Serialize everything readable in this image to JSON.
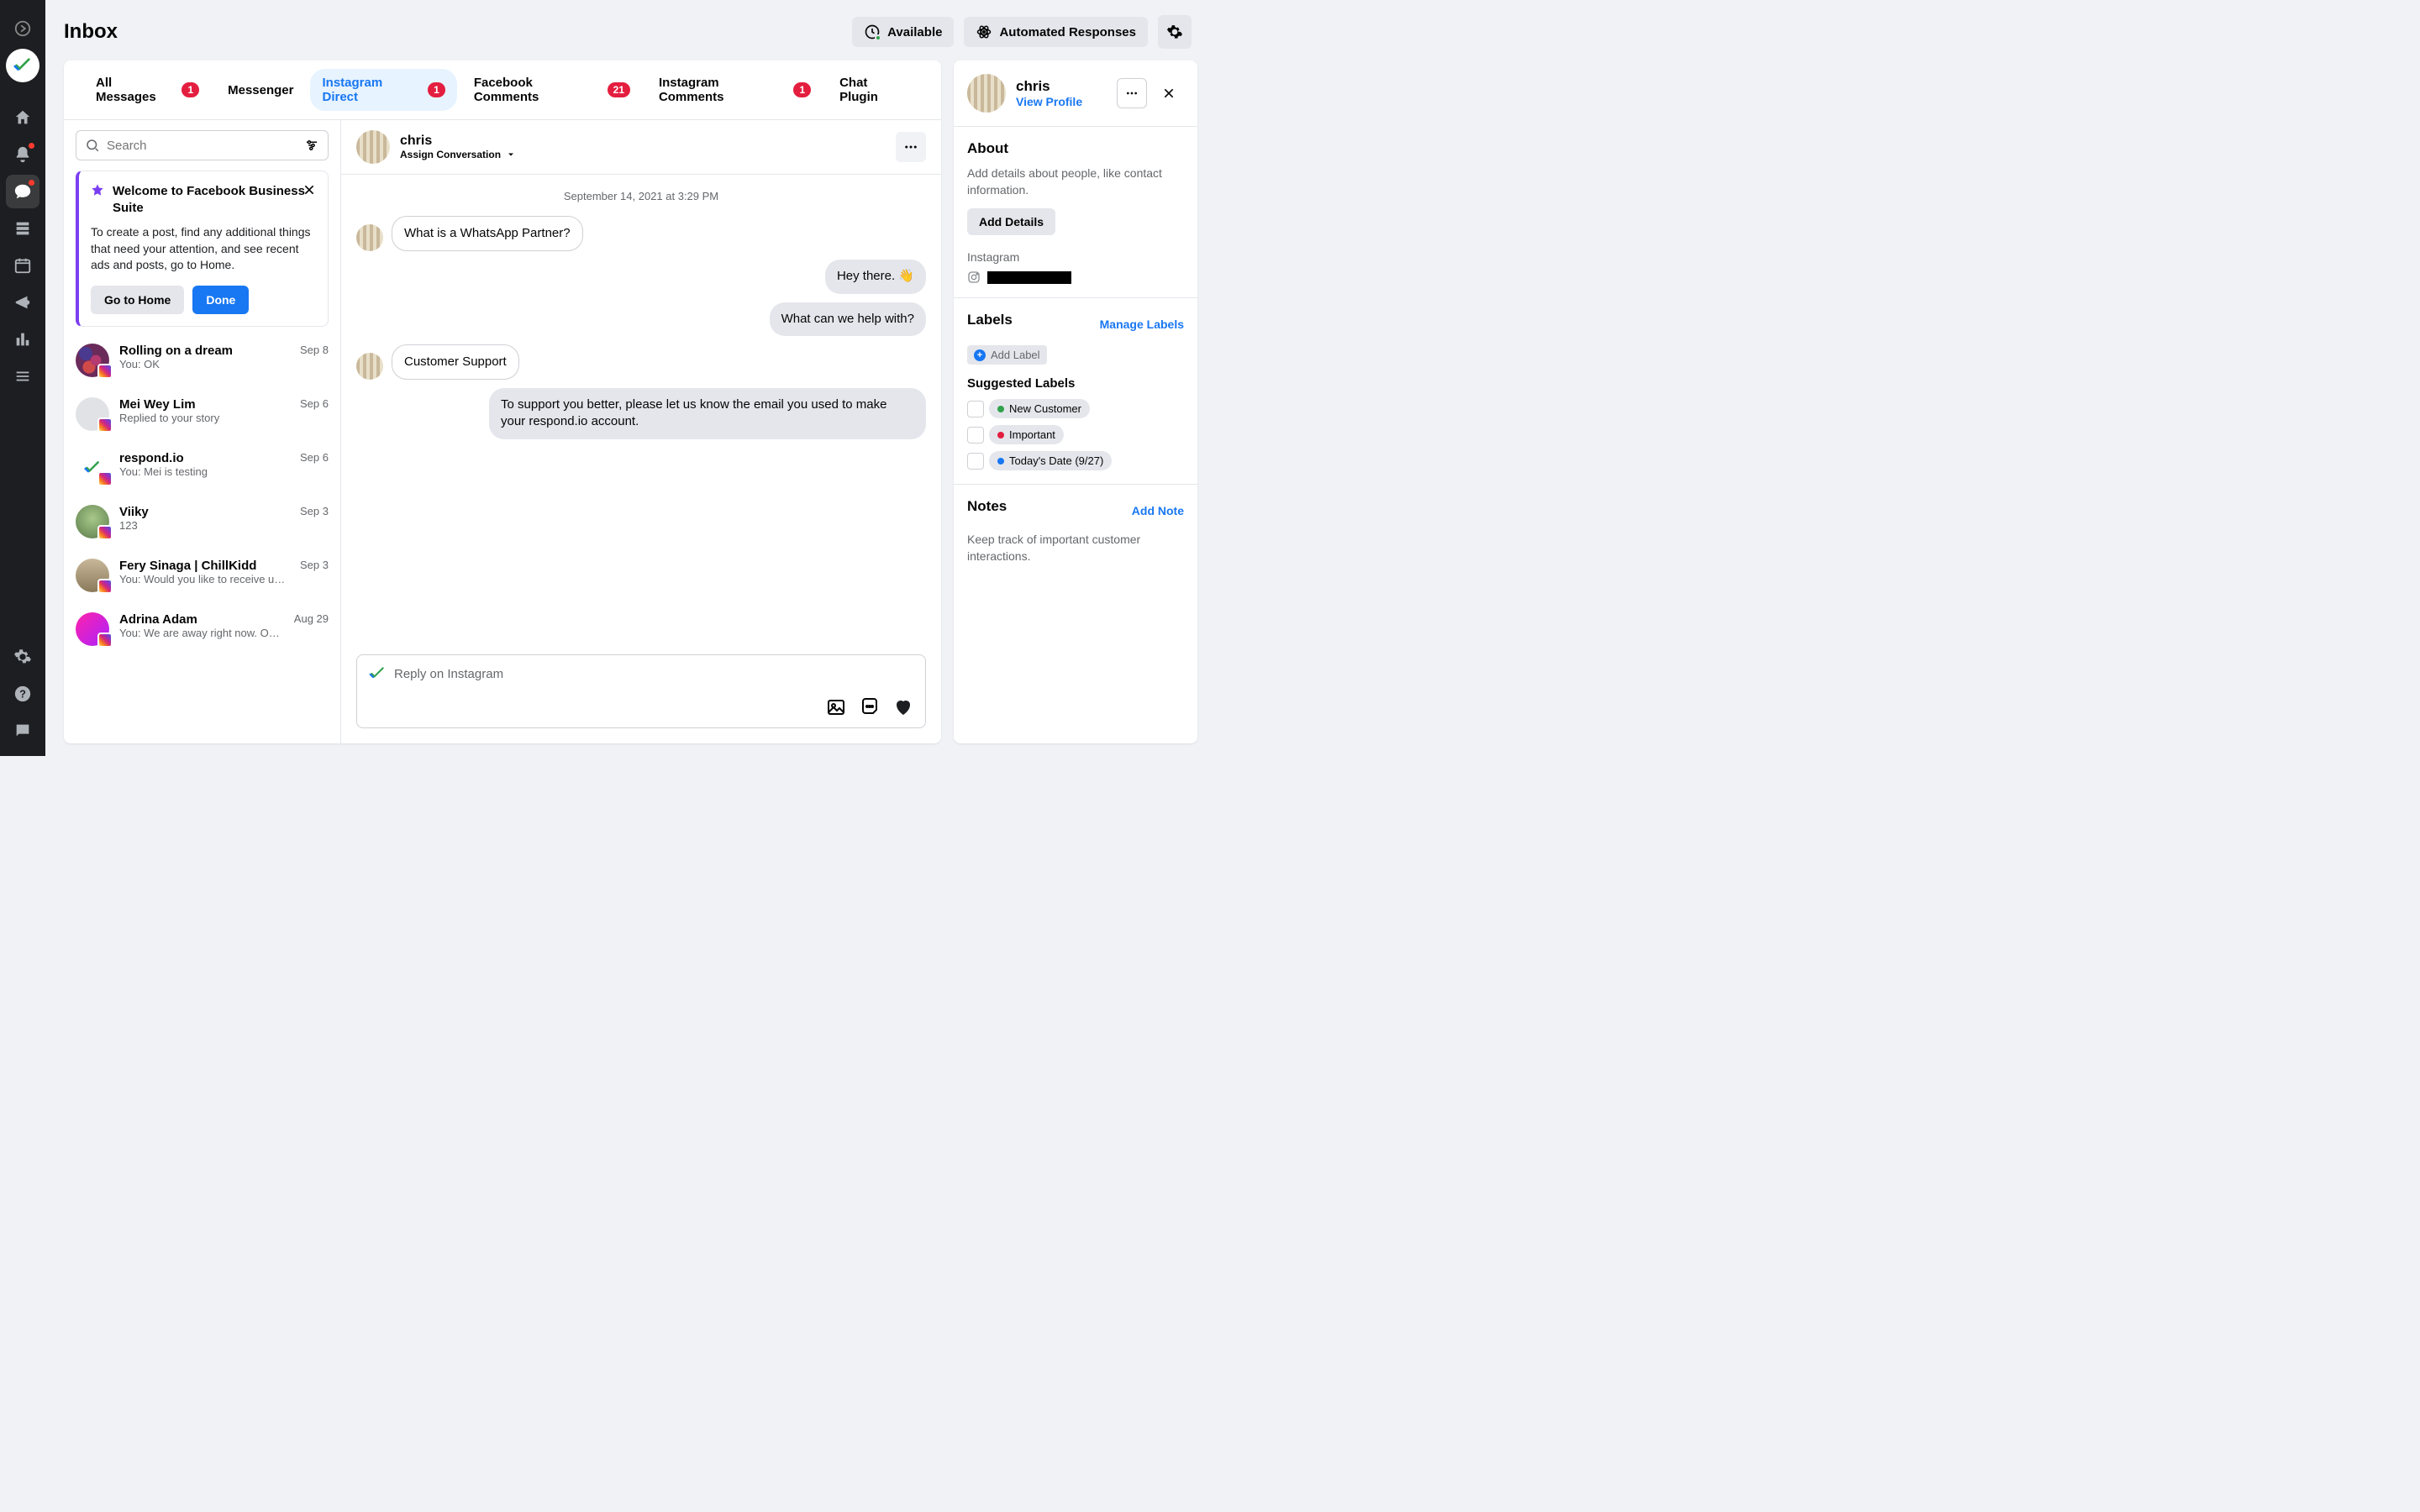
{
  "header": {
    "title": "Inbox",
    "available": "Available",
    "automated": "Automated Responses"
  },
  "tabs": [
    {
      "label": "All Messages",
      "badge": "1"
    },
    {
      "label": "Messenger",
      "badge": null
    },
    {
      "label": "Instagram Direct",
      "badge": "1",
      "active": true
    },
    {
      "label": "Facebook Comments",
      "badge": "21"
    },
    {
      "label": "Instagram Comments",
      "badge": "1"
    },
    {
      "label": "Chat Plugin",
      "badge": null
    }
  ],
  "search": {
    "placeholder": "Search"
  },
  "welcome": {
    "title": "Welcome to Facebook Business Suite",
    "body": "To create a post, find any additional things that need your attention, and see recent ads and posts, go to Home.",
    "go_home": "Go to Home",
    "done": "Done"
  },
  "conversations": [
    {
      "name": "Rolling on a dream",
      "snippet": "You: OK",
      "date": "Sep 8",
      "av": "av-berry"
    },
    {
      "name": "Mei Wey Lim",
      "snippet": "Replied to your story",
      "date": "Sep 6",
      "av": "av-grey"
    },
    {
      "name": "respond.io",
      "snippet": "You: Mei is testing",
      "date": "Sep 6",
      "av": "av-logo"
    },
    {
      "name": "Viiky",
      "snippet": "123",
      "date": "Sep 3",
      "av": "av-green"
    },
    {
      "name": "Fery Sinaga | ChillKidd",
      "snippet": "You: Would you like to receive update…",
      "date": "Sep 3",
      "av": "av-brown"
    },
    {
      "name": "Adrina Adam",
      "snippet": "You: We are away right now. Our usu…",
      "date": "Aug 29",
      "av": "av-pink"
    }
  ],
  "chat": {
    "name": "chris",
    "assign": "Assign Conversation",
    "timestamp": "September 14, 2021 at 3:29 PM",
    "messages": [
      {
        "side": "left",
        "text": "What is a WhatsApp Partner?"
      },
      {
        "side": "right",
        "text": "Hey there. 👋"
      },
      {
        "side": "right",
        "text": "What can we help with?"
      },
      {
        "side": "left",
        "text": "Customer Support"
      },
      {
        "side": "right-long",
        "text": "To support you better, please let us know the email you used to make your respond.io account."
      }
    ],
    "reply_placeholder": "Reply on Instagram"
  },
  "profile": {
    "name": "chris",
    "view_profile": "View Profile",
    "about_title": "About",
    "about_sub": "Add details about people, like contact information.",
    "add_details": "Add Details",
    "ig_label": "Instagram",
    "labels_title": "Labels",
    "manage_labels": "Manage Labels",
    "add_label": "Add Label",
    "suggested_title": "Suggested Labels",
    "suggested": [
      {
        "label": "New Customer",
        "color": "#31a24c"
      },
      {
        "label": "Important",
        "color": "#e41e3f"
      },
      {
        "label": "Today's Date (9/27)",
        "color": "#1877f2"
      }
    ],
    "notes_title": "Notes",
    "add_note": "Add Note",
    "notes_sub": "Keep track of important customer interactions."
  }
}
